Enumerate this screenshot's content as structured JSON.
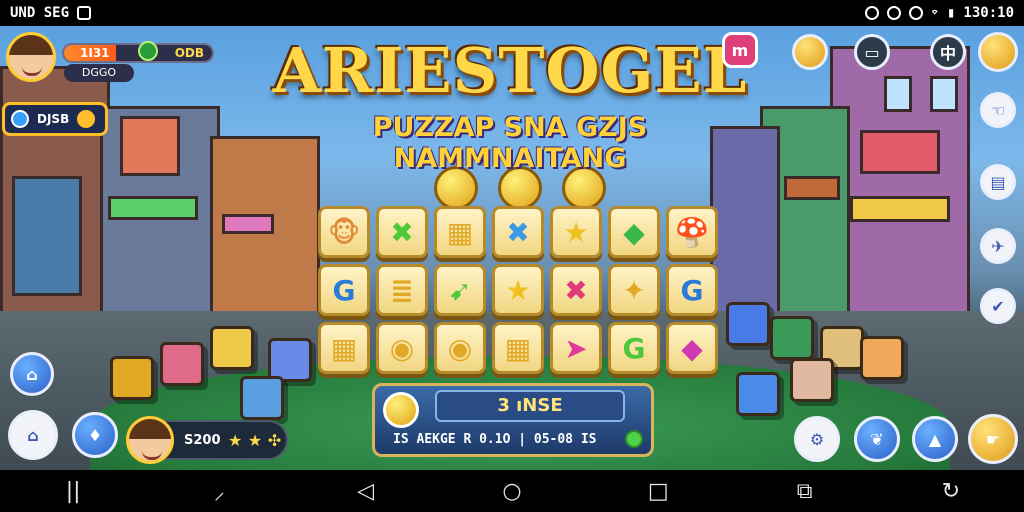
{
  "status_bar": {
    "left_text": "UND SEG",
    "time": "130:10"
  },
  "title": {
    "main": "ARIESTOGEL",
    "subtitle": "PUZZAP SNA GZJS NAMMNAITANG"
  },
  "hud": {
    "level_label": "1I31",
    "coins": "ODB",
    "sub_label": "DGGO",
    "left_panel_label": "DJSB",
    "progress_fraction": 0.35
  },
  "info_panel": {
    "title": "3 ıNSE",
    "line": "IS AEKGE R 0.1O | 05-08 IS"
  },
  "player": {
    "score": "S200"
  },
  "tiles": [
    [
      "🐵",
      "✖",
      "▦",
      "✖",
      "★",
      "◆",
      "🍄"
    ],
    [
      "G",
      "≣",
      "➹",
      "★",
      "✖",
      "✦",
      "G"
    ],
    [
      "▦",
      "◉",
      "◉",
      "▦",
      "➤",
      "G",
      "◆"
    ]
  ],
  "tile_colors": [
    [
      "#e08a3a",
      "#4ec83a",
      "#e0a824",
      "#3a9ae8",
      "#f0c020",
      "#3ab84a",
      "#e05a78"
    ],
    [
      "#2a7ad8",
      "#e0a824",
      "#4ec83a",
      "#f0c020",
      "#e03a7a",
      "#e0a824",
      "#2a7ad8"
    ],
    [
      "#e0a824",
      "#e0a824",
      "#e0a824",
      "#e0a824",
      "#e03a9a",
      "#4ec83a",
      "#d03ab0"
    ]
  ],
  "icons": {
    "top_right": [
      "m-badge-icon",
      "coin-badge-icon",
      "card-icon",
      "flag-icon",
      "hat-icon"
    ],
    "right_column": [
      "hand-icon",
      "scroll-icon",
      "plane-icon",
      "check-icon"
    ],
    "bottom_right": [
      "gear-icon",
      "leaf-icon",
      "arrow-icon",
      "hand-gold-icon"
    ]
  },
  "nav": [
    "||",
    "⸝",
    "◁",
    "○",
    "□",
    "⧉",
    "↻"
  ]
}
